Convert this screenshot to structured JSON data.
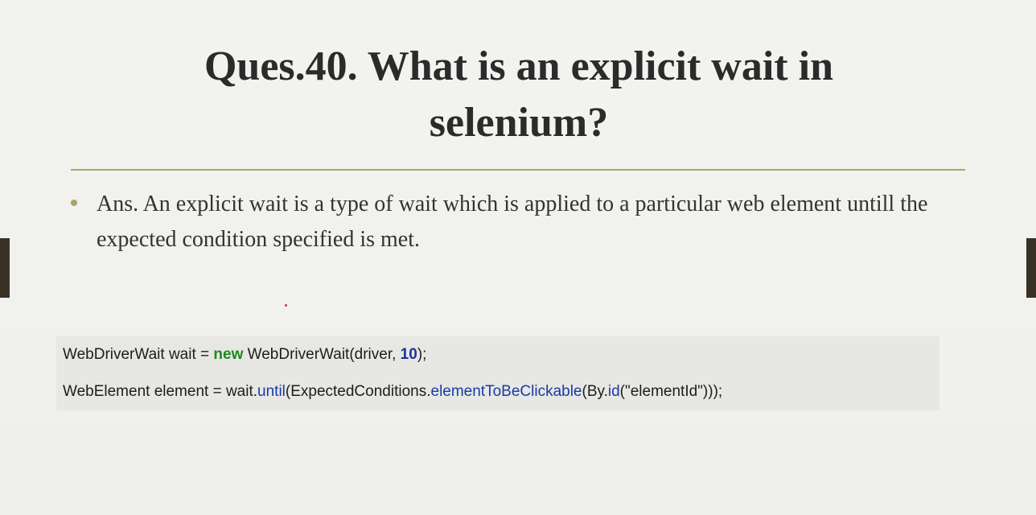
{
  "slide": {
    "title_line1": "Ques.40. What is an explicit wait in",
    "title_line2": "selenium?",
    "bullet": "Ans. An explicit wait is a type of wait which is applied to a particular web element untill the expected condition specified is met."
  },
  "code": {
    "line1": {
      "part1": "WebDriverWait wait = ",
      "keyword_new": "new",
      "part2": " WebDriverWait(driver, ",
      "number": "10",
      "part3": ");"
    },
    "line2": {
      "part1": "WebElement element = wait.",
      "method_until": "until",
      "part2": "(ExpectedConditions.",
      "method_clickable": "elementToBeClickable",
      "part3": "(By.",
      "method_id": "id",
      "part4": "(\"elementId\")));"
    }
  },
  "colors": {
    "accent": "#a9a56a",
    "keyword": "#1e8a1e",
    "method": "#1a3aa6",
    "number": "#1a3399",
    "edge_tab": "#3a3125"
  }
}
